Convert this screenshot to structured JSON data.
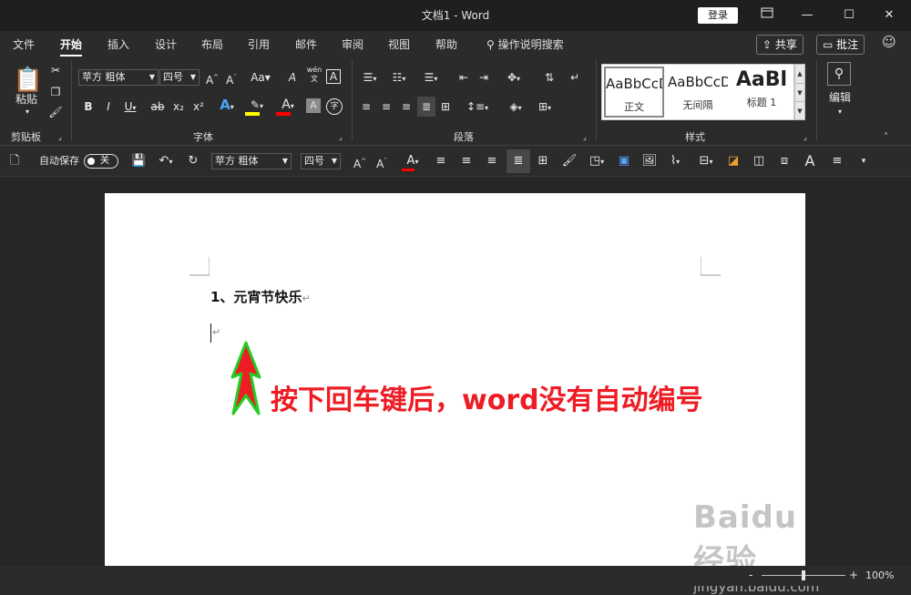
{
  "window": {
    "title": "文档1  -  Word",
    "login": "登录",
    "ribbon_display_icon": "ribbon-display-icon",
    "min": "—",
    "max": "☐",
    "close": "✕"
  },
  "menu": {
    "items": [
      "文件",
      "开始",
      "插入",
      "设计",
      "布局",
      "引用",
      "邮件",
      "审阅",
      "视图",
      "帮助"
    ],
    "active": "开始",
    "tell_me": "操作说明搜索",
    "share": "共享",
    "comment": "批注"
  },
  "ribbon": {
    "clipboard": {
      "paste": "粘贴",
      "label": "剪贴板"
    },
    "font": {
      "name": "苹方 粗体",
      "size": "四号",
      "grow": "A^",
      "shrink": "A˅",
      "case": "Aa",
      "clear": "A",
      "phonetic": "wén",
      "border": "A",
      "bold": "B",
      "italic": "I",
      "underline": "U",
      "strike": "ab",
      "sub": "x₂",
      "sup": "x²",
      "effects": "A",
      "highlight_color": "#ffff00",
      "font_color": "#ff0000",
      "shading": "A",
      "enclose": "字",
      "label": "字体"
    },
    "paragraph": {
      "label": "段落"
    },
    "styles": {
      "items": [
        {
          "preview": "AaBbCcD",
          "name": "正文"
        },
        {
          "preview": "AaBbCcD",
          "name": "无间隔"
        },
        {
          "preview": "AaBl",
          "name": "标题 1"
        }
      ],
      "label": "样式"
    },
    "editing": {
      "label": "编辑"
    }
  },
  "qat": {
    "autosave": "自动保存",
    "toggle": "关",
    "font_name": "苹方 粗体",
    "font_size": "四号"
  },
  "document": {
    "line1": "1、元宵节快乐",
    "pilcrow": "↵"
  },
  "annotation": {
    "text": "按下回车键后，word没有自动编号",
    "arrow_color": "#ee1c24",
    "outline_color": "#22cc22"
  },
  "watermark": {
    "brand": "Baidu经验",
    "url": "jingyan.baidu.com"
  },
  "status": {
    "zoom": "100%",
    "minus": "-",
    "plus": "+",
    "zoom_level": 100
  }
}
